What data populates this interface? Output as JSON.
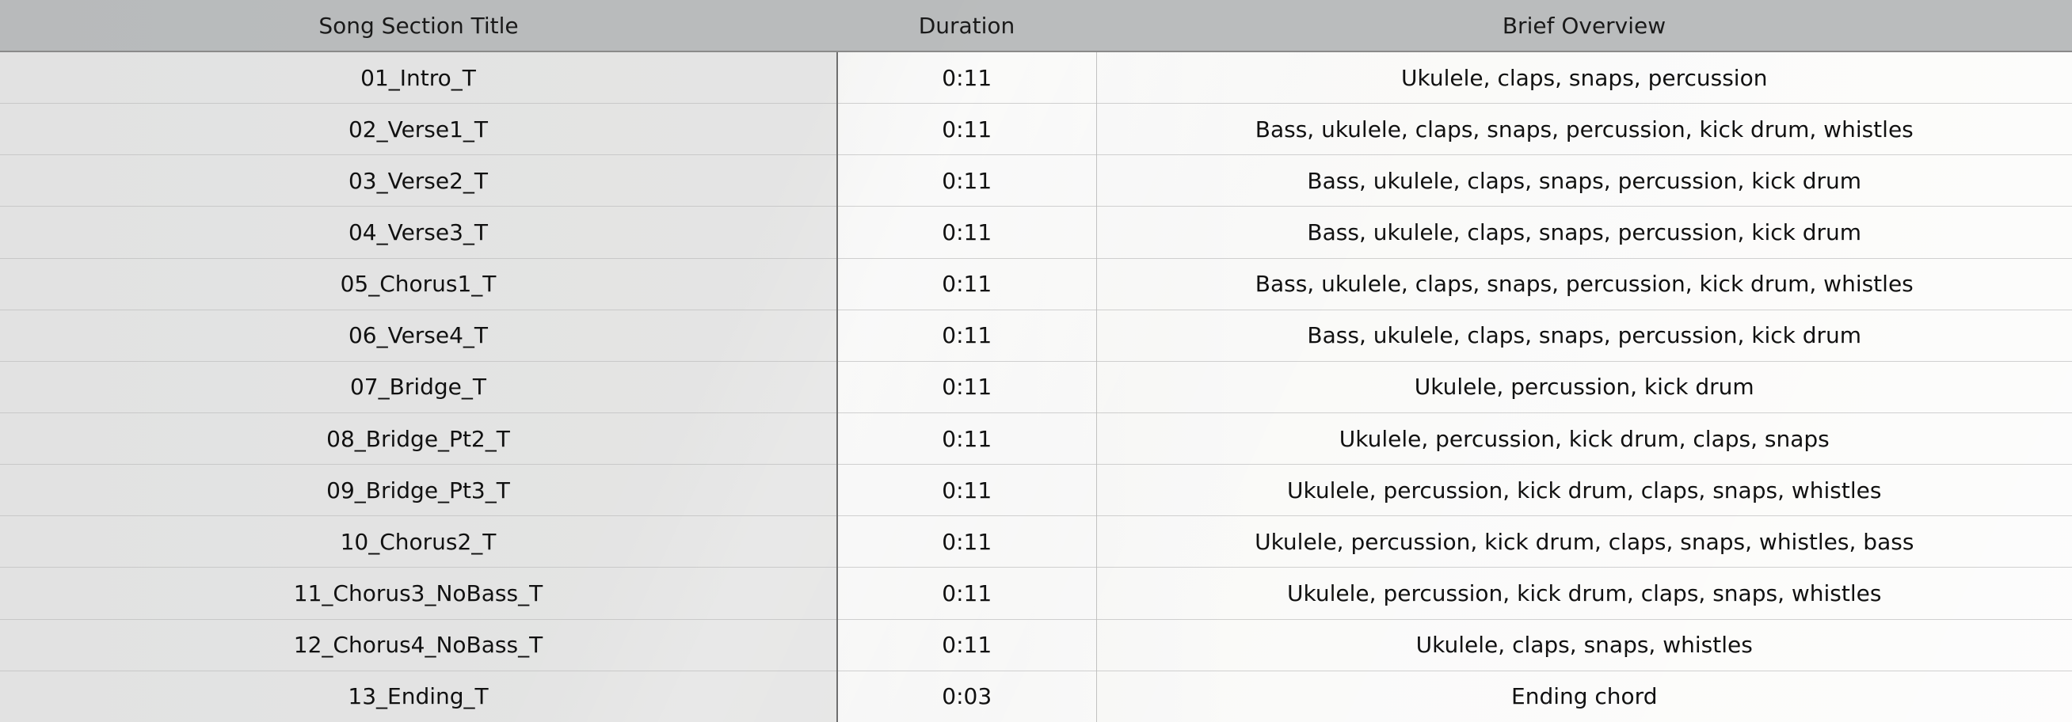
{
  "table": {
    "headers": {
      "title": "Song Section Title",
      "duration": "Duration",
      "overview": "Brief Overview"
    },
    "rows": [
      {
        "title": "01_Intro_T",
        "duration": "0:11",
        "overview": "Ukulele, claps, snaps, percussion"
      },
      {
        "title": "02_Verse1_T",
        "duration": "0:11",
        "overview": "Bass, ukulele, claps, snaps, percussion, kick drum, whistles"
      },
      {
        "title": "03_Verse2_T",
        "duration": "0:11",
        "overview": "Bass, ukulele, claps, snaps, percussion, kick drum"
      },
      {
        "title": "04_Verse3_T",
        "duration": "0:11",
        "overview": "Bass, ukulele, claps, snaps, percussion, kick drum"
      },
      {
        "title": "05_Chorus1_T",
        "duration": "0:11",
        "overview": "Bass, ukulele, claps, snaps, percussion, kick drum, whistles"
      },
      {
        "title": "06_Verse4_T",
        "duration": "0:11",
        "overview": "Bass, ukulele, claps, snaps, percussion, kick drum"
      },
      {
        "title": "07_Bridge_T",
        "duration": "0:11",
        "overview": "Ukulele, percussion, kick drum"
      },
      {
        "title": "08_Bridge_Pt2_T",
        "duration": "0:11",
        "overview": "Ukulele, percussion, kick drum, claps, snaps"
      },
      {
        "title": "09_Bridge_Pt3_T",
        "duration": "0:11",
        "overview": "Ukulele, percussion, kick drum, claps, snaps, whistles"
      },
      {
        "title": "10_Chorus2_T",
        "duration": "0:11",
        "overview": "Ukulele, percussion, kick drum, claps, snaps, whistles, bass"
      },
      {
        "title": "11_Chorus3_NoBass_T",
        "duration": "0:11",
        "overview": "Ukulele, percussion, kick drum, claps, snaps, whistles"
      },
      {
        "title": "12_Chorus4_NoBass_T",
        "duration": "0:11",
        "overview": "Ukulele, claps, snaps, whistles"
      },
      {
        "title": "13_Ending_T",
        "duration": "0:03",
        "overview": "Ending chord"
      }
    ]
  }
}
